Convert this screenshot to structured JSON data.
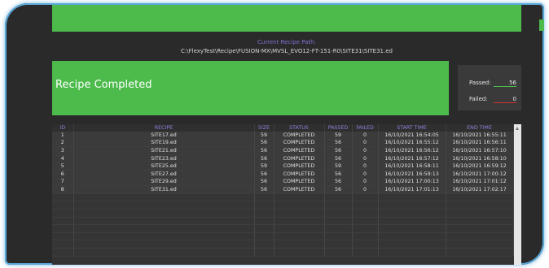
{
  "header": {
    "recipe_path_label": "Current Recipe Path:",
    "recipe_path": "C:\\FlexyTest\\Recipe\\FUSION-MX\\MVSL_EVO12-FT-151-R0\\SITE31\\SITE31.ed"
  },
  "status": {
    "text": "Recipe Completed",
    "passed_label": "Passed:",
    "passed_value": "56",
    "failed_label": "Failed:",
    "failed_value": "0"
  },
  "table": {
    "headers": [
      "ID",
      "RECIPE",
      "SIZE",
      "STATUS",
      "PASSED",
      "FAILED",
      "START TIME",
      "END TIME"
    ],
    "rows": [
      [
        "1",
        "SITE17.ed",
        "59",
        "COMPLETED",
        "59",
        "0",
        "16/10/2021 16:54:05",
        "16/10/2021 16:55:11"
      ],
      [
        "2",
        "SITE19.ed",
        "56",
        "COMPLETED",
        "56",
        "0",
        "16/10/2021 16:55:12",
        "16/10/2021 16:56:11"
      ],
      [
        "3",
        "SITE21.ed",
        "56",
        "COMPLETED",
        "56",
        "0",
        "16/10/2021 16:56:12",
        "16/10/2021 16:57:10"
      ],
      [
        "4",
        "SITE23.ed",
        "56",
        "COMPLETED",
        "56",
        "0",
        "16/10/2021 16:57:12",
        "16/10/2021 16:58:10"
      ],
      [
        "5",
        "SITE25.ed",
        "59",
        "COMPLETED",
        "59",
        "0",
        "16/10/2021 16:58:11",
        "16/10/2021 16:59:12"
      ],
      [
        "6",
        "SITE27.ed",
        "56",
        "COMPLETED",
        "56",
        "0",
        "16/10/2021 16:59:13",
        "16/10/2021 17:00:12"
      ],
      [
        "7",
        "SITE29.ed",
        "56",
        "COMPLETED",
        "56",
        "0",
        "16/10/2021 17:00:13",
        "16/10/2021 17:01:12"
      ],
      [
        "8",
        "SITE31.ed",
        "56",
        "COMPLETED",
        "56",
        "0",
        "16/10/2021 17:01:13",
        "16/10/2021 17:02:17"
      ]
    ]
  },
  "colors": {
    "accent_green": "#4cbb4c",
    "header_purple": "#8d7fd8",
    "failed_red": "#d63030"
  }
}
